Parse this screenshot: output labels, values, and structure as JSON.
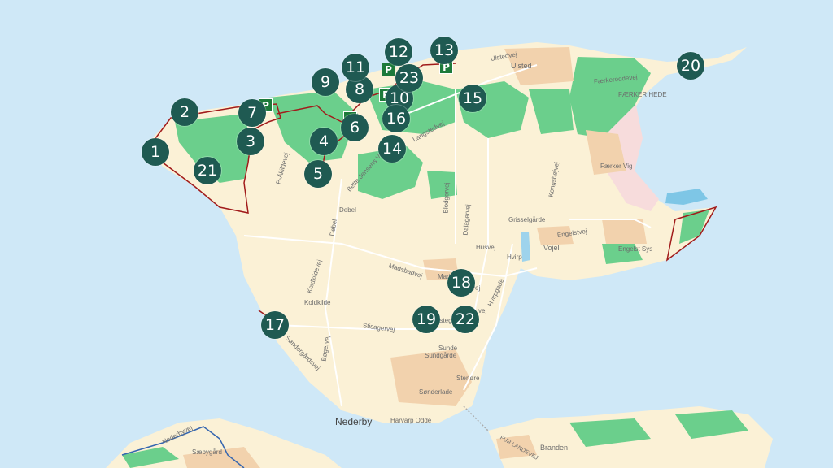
{
  "colors": {
    "sea": "#cfe8f7",
    "land": "#fbf1d6",
    "forest": "#6bcf8c",
    "urban": "#f2d2ad",
    "boundary": "#a11b1b",
    "marker": "#1f5a52",
    "parking": "#1d7a3a"
  },
  "markers": [
    "1",
    "2",
    "3",
    "4",
    "5",
    "6",
    "7",
    "8",
    "9",
    "10",
    "11",
    "12",
    "13",
    "14",
    "15",
    "16",
    "17",
    "18",
    "19",
    "20",
    "21",
    "22",
    "23"
  ],
  "parking": {
    "label": "P"
  },
  "places": {
    "ulsted": "Ulsted",
    "faerker_hede": "FÆRKER HEDE",
    "faerker_vig": "Færker Vig",
    "grisselgarde": "Grisselgårde",
    "vojel": "Vojel",
    "engelst_sys": "Engelst Sys",
    "hvirp": "Hvirp",
    "debel": "Debel",
    "koldkilde": "Koldkilde",
    "madeb": "Madeb",
    "sunde": "Sunde",
    "sundgarde": "Sundgårde",
    "stenore": "Stenøre",
    "sonderlade": "Sønderlade",
    "harvarp_odde": "Harvarp Odde",
    "nederby": "Nederby",
    "branden": "Branden",
    "saebygard": "Sæbygård"
  },
  "roads": {
    "ulstedvej": "Ulstedvej",
    "faerkeroddevej": "Færkeroddevej",
    "langstedvej": "Langstedvej",
    "bette_jensens_vej": "Bette Jensens Vej",
    "pakildevej": "P-Åkildevej",
    "bloddgervej": "Blodgervej",
    "dalagervej": "Dalagervej",
    "kongshojvej": "Kongshøjvej",
    "engelstvej": "Engelstvej",
    "husvej": "Husvej",
    "hvirpgade": "Hvirpgade",
    "madsbadvej": "Madsbadvej",
    "koldkildevej": "Koldkildevej",
    "stisagervej": "Stisagervej",
    "bogervej": "Bøgervej",
    "sondergardsvej": "Søndergårdsvej",
    "debel_road": "Debel",
    "nederbyvej": "Nederbyvej",
    "fur_landevej": "FUR LANDEVEJ",
    "vej22": "vej",
    "vej18": "vej",
    "vej19": "estega"
  }
}
